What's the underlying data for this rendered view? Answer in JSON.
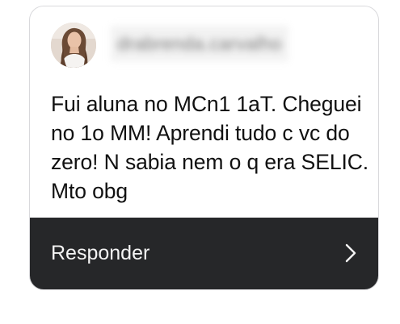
{
  "card": {
    "username": "drabrenda.carvalho",
    "avatar_icon": "profile-photo",
    "message": "Fui aluna no MCn1 1aT. Cheguei no 1o MM! Aprendi tudo c vc do zero! N sabia nem o q era SELIC. Mto obg",
    "reply_label": "Responder",
    "reply_icon": "chevron-right-icon"
  },
  "colors": {
    "reply_bar_bg": "#262729",
    "reply_text": "#f4f4f4",
    "message_text": "#111111"
  }
}
